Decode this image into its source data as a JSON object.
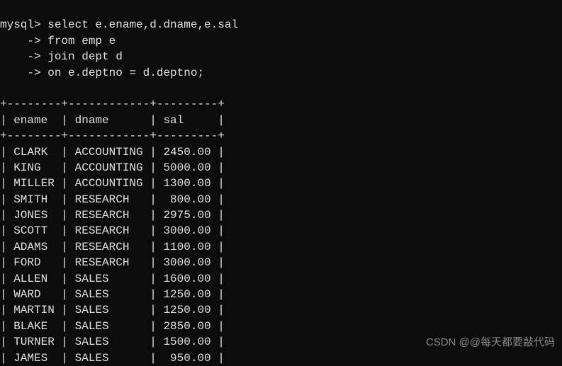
{
  "query": {
    "prompt": "mysql>",
    "cont": "    ->",
    "lines": [
      "select e.ename,d.dname,e.sal",
      "from emp e",
      "join dept d",
      "on e.deptno = d.deptno;"
    ]
  },
  "table": {
    "sep_top": "+--------+------------+---------+",
    "sep_mid": "+--------+------------+---------+",
    "header": {
      "c0": "ename",
      "c1": "dname",
      "c2": "sal"
    },
    "rows": [
      {
        "ename": "CLARK",
        "dname": "ACCOUNTING",
        "sal": "2450.00"
      },
      {
        "ename": "KING",
        "dname": "ACCOUNTING",
        "sal": "5000.00"
      },
      {
        "ename": "MILLER",
        "dname": "ACCOUNTING",
        "sal": "1300.00"
      },
      {
        "ename": "SMITH",
        "dname": "RESEARCH",
        "sal": "800.00"
      },
      {
        "ename": "JONES",
        "dname": "RESEARCH",
        "sal": "2975.00"
      },
      {
        "ename": "SCOTT",
        "dname": "RESEARCH",
        "sal": "3000.00"
      },
      {
        "ename": "ADAMS",
        "dname": "RESEARCH",
        "sal": "1100.00"
      },
      {
        "ename": "FORD",
        "dname": "RESEARCH",
        "sal": "3000.00"
      },
      {
        "ename": "ALLEN",
        "dname": "SALES",
        "sal": "1600.00"
      },
      {
        "ename": "WARD",
        "dname": "SALES",
        "sal": "1250.00"
      },
      {
        "ename": "MARTIN",
        "dname": "SALES",
        "sal": "1250.00"
      },
      {
        "ename": "BLAKE",
        "dname": "SALES",
        "sal": "2850.00"
      },
      {
        "ename": "TURNER",
        "dname": "SALES",
        "sal": "1500.00"
      },
      {
        "ename": "JAMES",
        "dname": "SALES",
        "sal": "950.00"
      }
    ]
  },
  "watermark": "CSDN @@每天都要敲代码",
  "chart_data": {
    "type": "table",
    "columns": [
      "ename",
      "dname",
      "sal"
    ],
    "rows": [
      [
        "CLARK",
        "ACCOUNTING",
        2450.0
      ],
      [
        "KING",
        "ACCOUNTING",
        5000.0
      ],
      [
        "MILLER",
        "ACCOUNTING",
        1300.0
      ],
      [
        "SMITH",
        "RESEARCH",
        800.0
      ],
      [
        "JONES",
        "RESEARCH",
        2975.0
      ],
      [
        "SCOTT",
        "RESEARCH",
        3000.0
      ],
      [
        "ADAMS",
        "RESEARCH",
        1100.0
      ],
      [
        "FORD",
        "RESEARCH",
        3000.0
      ],
      [
        "ALLEN",
        "SALES",
        1600.0
      ],
      [
        "WARD",
        "SALES",
        1250.0
      ],
      [
        "MARTIN",
        "SALES",
        1250.0
      ],
      [
        "BLAKE",
        "SALES",
        2850.0
      ],
      [
        "TURNER",
        "SALES",
        1500.0
      ],
      [
        "JAMES",
        "SALES",
        950.0
      ]
    ]
  }
}
